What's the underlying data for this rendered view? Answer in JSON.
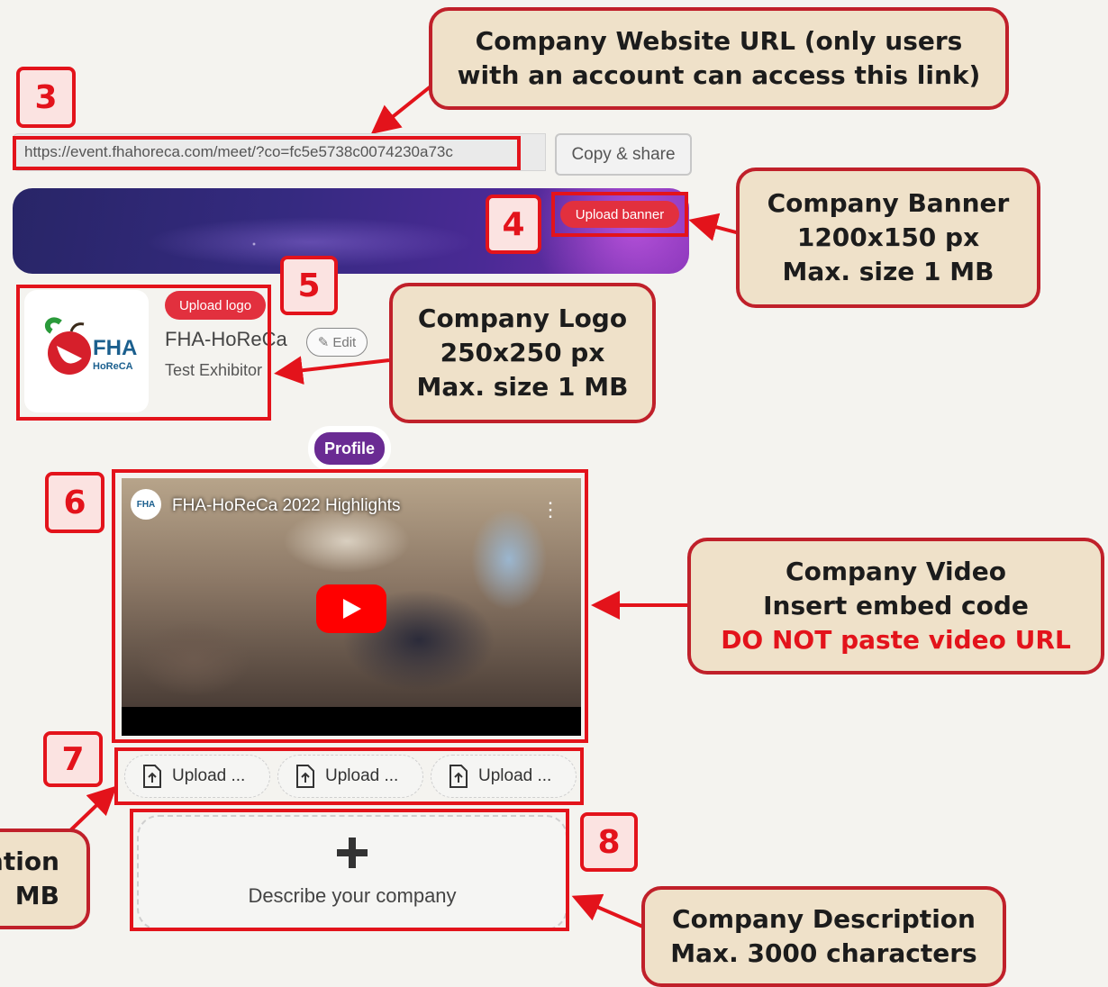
{
  "callouts": {
    "website": {
      "line1": "Company Website URL (only users",
      "line2": "with an account can access this link)"
    },
    "banner": {
      "line1": "Company Banner",
      "line2": "1200x150 px",
      "line3": "Max. size 1 MB"
    },
    "logo": {
      "line1": "Company Logo",
      "line2": "250x250 px",
      "line3": "Max. size 1 MB"
    },
    "video": {
      "line1": "Company Video",
      "line2": "Insert embed code",
      "line3": "DO NOT paste video URL"
    },
    "presentation": {
      "line1": "ntion",
      "line2": "MB"
    },
    "description": {
      "line1": "Company Description",
      "line2": "Max. 3000 characters"
    }
  },
  "badges": {
    "b3": "3",
    "b4": "4",
    "b5": "5",
    "b6": "6",
    "b7": "7",
    "b8": "8"
  },
  "url_bar": {
    "value": "https://event.fhahoreca.com/meet/?co=fc5e5738c0074230a73c",
    "copy_label": "Copy & share"
  },
  "banner": {
    "upload_label": "Upload banner"
  },
  "company": {
    "upload_logo_label": "Upload logo",
    "name": "FHA-HoReCa",
    "edit_label": "Edit",
    "subtitle": "Test Exhibitor",
    "logo_text_top": "FHA",
    "logo_text_bottom": "HoReCA"
  },
  "tabs": {
    "profile": "Profile"
  },
  "video": {
    "title": "FHA-HoReCa 2022 Highlights",
    "channel_badge": "FHA"
  },
  "uploads": [
    {
      "label": "Upload ..."
    },
    {
      "label": "Upload ..."
    },
    {
      "label": "Upload ..."
    }
  ],
  "describe": {
    "label": "Describe your company"
  },
  "colors": {
    "accent_red": "#e3131b",
    "callout_bg": "#efe1c9",
    "profile_purple": "#6a2b93"
  }
}
